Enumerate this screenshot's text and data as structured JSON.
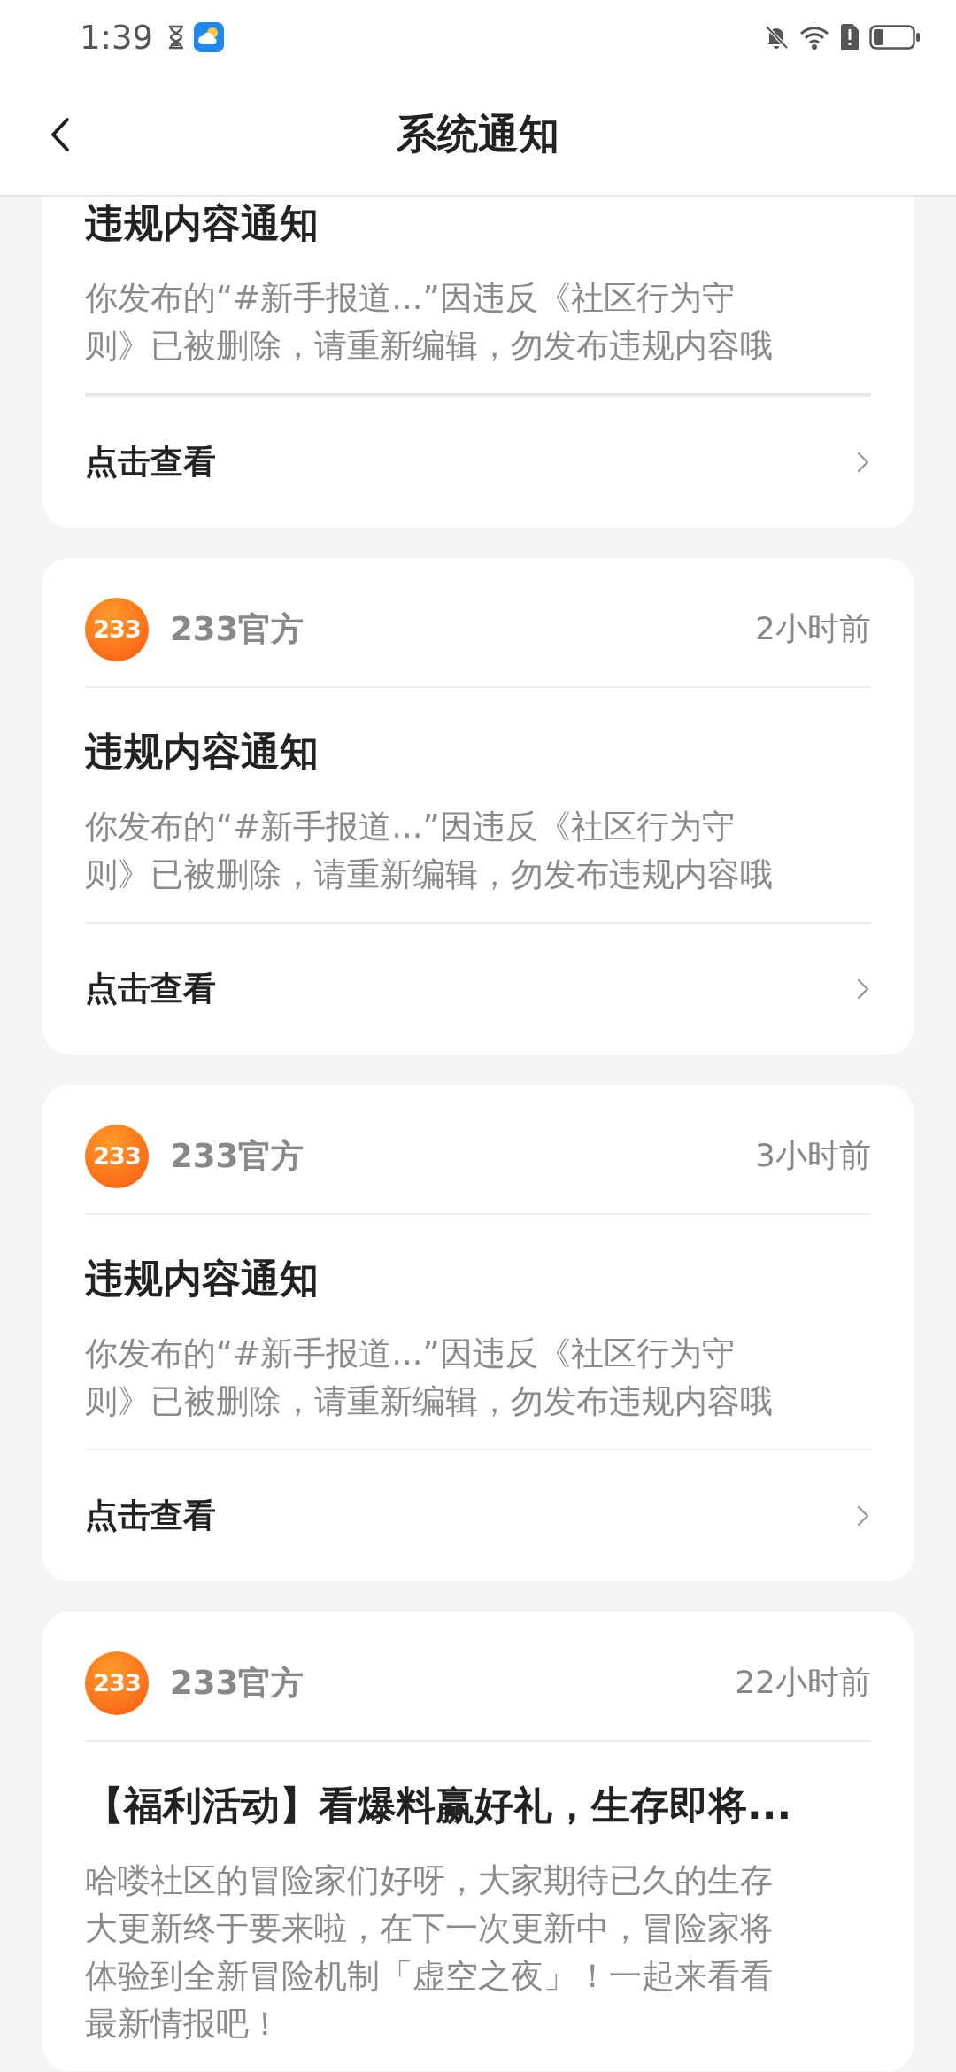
{
  "status_bar": {
    "time": "1:39"
  },
  "header": {
    "title": "系统通知"
  },
  "notifications": [
    {
      "title": "违规内容通知",
      "body": "你发布的“#新手报道...”因违反《社区行为守则》已被删除，请重新编辑，勿发布违规内容哦",
      "link": "点击查看"
    },
    {
      "avatar_text": "233",
      "sender": "233官方",
      "time": "2小时前",
      "title": "违规内容通知",
      "body": "你发布的“#新手报道...”因违反《社区行为守则》已被删除，请重新编辑，勿发布违规内容哦",
      "link": "点击查看"
    },
    {
      "avatar_text": "233",
      "sender": "233官方",
      "time": "3小时前",
      "title": "违规内容通知",
      "body": "你发布的“#新手报道...”因违反《社区行为守则》已被删除，请重新编辑，勿发布违规内容哦",
      "link": "点击查看"
    },
    {
      "avatar_text": "233",
      "sender": "233官方",
      "time": "22小时前",
      "title": "【福利活动】看爆料赢好礼，生存即将...",
      "body": "哈喽社区的冒险家们好呀，大家期待已久的生存大更新终于要来啦，在下一次更新中，冒险家将体验到全新冒险机制「虚空之夜」！一起来看看最新情报吧！"
    }
  ]
}
